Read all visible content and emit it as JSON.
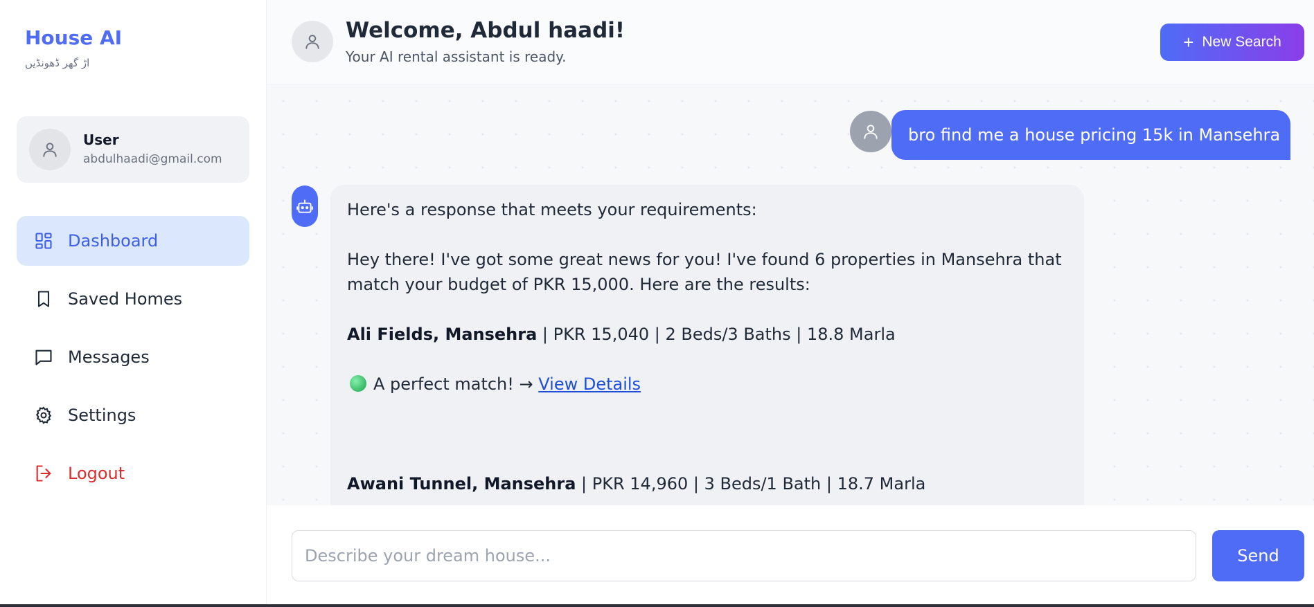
{
  "sidebar": {
    "brand": "House AI",
    "tagline": "اڑ گھر ڈھونڈیں",
    "user": {
      "name": "User",
      "email": "abdulhaadi@gmail.com"
    },
    "nav": [
      {
        "label": "Dashboard",
        "icon": "dashboard-icon",
        "active": true
      },
      {
        "label": "Saved Homes",
        "icon": "bookmark-icon"
      },
      {
        "label": "Messages",
        "icon": "message-icon"
      },
      {
        "label": "Settings",
        "icon": "gear-icon"
      },
      {
        "label": "Logout",
        "icon": "logout-icon",
        "color": "#d92d2d"
      }
    ]
  },
  "header": {
    "title": "Welcome, Abdul haadi!",
    "subtitle": "Your AI rental assistant is ready.",
    "new_search_label": "New Search"
  },
  "chat": {
    "user_message": "bro find me a house pricing 15k in Mansehra",
    "bot": {
      "intro": "Here's a response that meets your requirements:",
      "summary": "Hey there! I've got some great news for you! I've found 6 properties in Mansehra that match your budget of PKR 15,000. Here are the results:",
      "listings": [
        {
          "name": "Ali Fields, Mansehra",
          "details": " | PKR 15,040 | 2 Beds/3 Baths | 18.8 Marla",
          "note": "A perfect match! →",
          "link": "View Details"
        },
        {
          "name": "Awani Tunnel, Mansehra",
          "details": " | PKR 14,960 | 3 Beds/1 Bath | 18.7 Marla"
        }
      ]
    }
  },
  "composer": {
    "placeholder": "Describe your dream house...",
    "send_label": "Send"
  },
  "colors": {
    "accent": "#4f6cf7",
    "gradient_end": "#8a3ee8",
    "active_nav_bg": "#dbe7fd",
    "logout": "#d92d2d"
  }
}
